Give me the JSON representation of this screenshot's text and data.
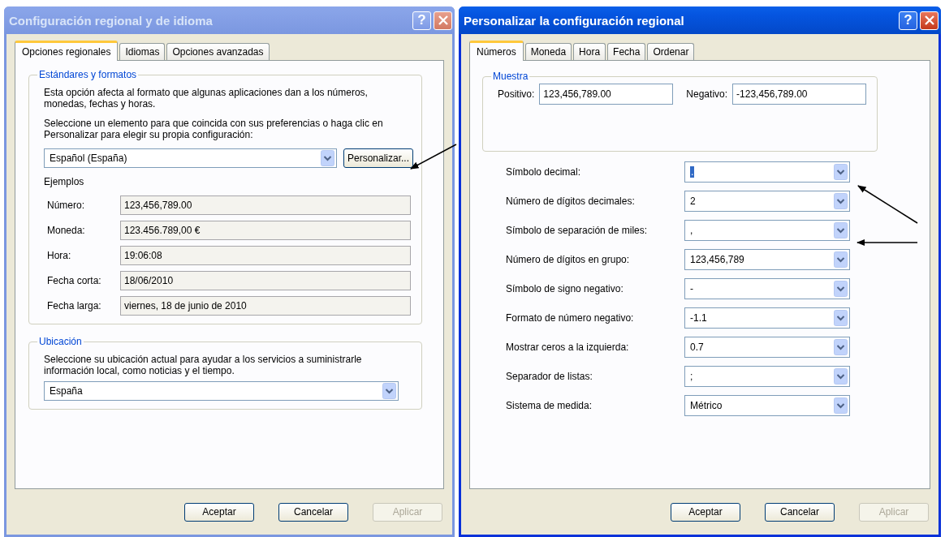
{
  "regional_dialog": {
    "title": "Configuración regional y de idioma",
    "active": false,
    "help_button": "?",
    "tabs": [
      {
        "label": "Opciones regionales",
        "selected": true
      },
      {
        "label": "Idiomas",
        "selected": false
      },
      {
        "label": "Opciones avanzadas",
        "selected": false
      }
    ],
    "standards": {
      "legend": "Estándares y formatos",
      "description": "Esta opción afecta al formato que algunas aplicaciones dan a los números, monedas, fechas y horas.",
      "instruction": "Seleccione un elemento para que coincida con sus preferencias o haga clic en Personalizar para elegir su propia configuración:",
      "locale": "Español (España)",
      "customize_button": "Personalizar...",
      "examples_label": "Ejemplos",
      "examples": [
        {
          "label": "Número:",
          "value": "123,456,789.00"
        },
        {
          "label": "Moneda:",
          "value": "123.456.789,00 €"
        },
        {
          "label": "Hora:",
          "value": "19:06:08"
        },
        {
          "label": "Fecha corta:",
          "value": "18/06/2010"
        },
        {
          "label": "Fecha larga:",
          "value": "viernes, 18 de junio de 2010"
        }
      ]
    },
    "location": {
      "legend": "Ubicación",
      "description": "Seleccione su ubicación actual para ayudar a los servicios a suministrarle información local, como noticias y el tiempo.",
      "value": "España"
    },
    "buttons": [
      {
        "label": "Aceptar",
        "disabled": false
      },
      {
        "label": "Cancelar",
        "disabled": false
      },
      {
        "label": "Aplicar",
        "disabled": true
      }
    ]
  },
  "customize_dialog": {
    "title": "Personalizar la configuración regional",
    "active": true,
    "help_button": "?",
    "tabs": [
      {
        "label": "Números",
        "selected": true
      },
      {
        "label": "Moneda",
        "selected": false
      },
      {
        "label": "Hora",
        "selected": false
      },
      {
        "label": "Fecha",
        "selected": false
      },
      {
        "label": "Ordenar",
        "selected": false
      }
    ],
    "sample": {
      "legend": "Muestra",
      "positive_label": "Positivo:",
      "positive": "123,456,789.00",
      "negative_label": "Negativo:",
      "negative": "-123,456,789.00"
    },
    "settings": [
      {
        "label": "Símbolo decimal:",
        "value": ".",
        "highlighted": true
      },
      {
        "label": "Número de dígitos decimales:",
        "value": "2",
        "highlighted": false
      },
      {
        "label": "Símbolo de separación de miles:",
        "value": ",",
        "highlighted": false
      },
      {
        "label": "Número de dígitos en grupo:",
        "value": "123,456,789",
        "highlighted": false
      },
      {
        "label": "Símbolo de signo negativo:",
        "value": "-",
        "highlighted": false
      },
      {
        "label": "Formato de número negativo:",
        "value": "-1.1",
        "highlighted": false
      },
      {
        "label": "Mostrar ceros a la izquierda:",
        "value": "0.7",
        "highlighted": false
      },
      {
        "label": "Separador de listas:",
        "value": ";",
        "highlighted": false
      },
      {
        "label": "Sistema de medida:",
        "value": "Métrico",
        "highlighted": false
      }
    ],
    "buttons": [
      {
        "label": "Aceptar",
        "disabled": false
      },
      {
        "label": "Cancelar",
        "disabled": false
      },
      {
        "label": "Aplicar",
        "disabled": true
      }
    ]
  }
}
